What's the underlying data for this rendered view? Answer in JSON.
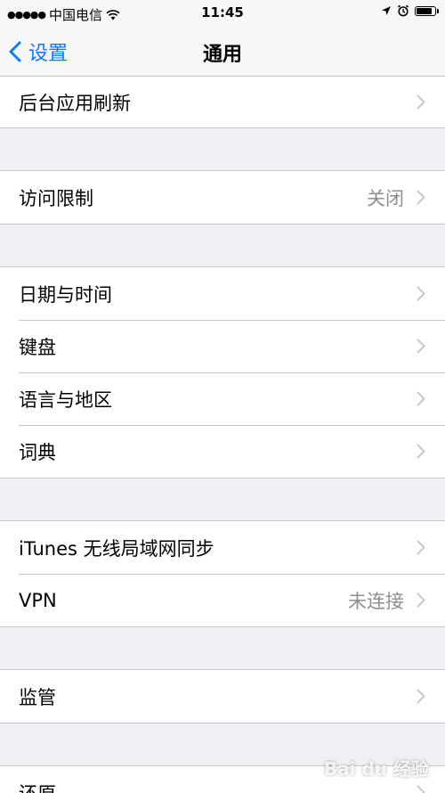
{
  "status_bar": {
    "carrier": "中国电信",
    "time": "11:45",
    "battery_level": 0.9,
    "signal_icon": "signal-dots",
    "wifi_icon": "wifi-icon",
    "location_icon": "location-arrow-icon",
    "alarm_icon": "alarm-icon"
  },
  "nav": {
    "back_label": "设置",
    "title": "通用"
  },
  "groups": [
    {
      "items": [
        {
          "label": "后台应用刷新",
          "value": ""
        }
      ]
    },
    {
      "items": [
        {
          "label": "访问限制",
          "value": "关闭"
        }
      ]
    },
    {
      "items": [
        {
          "label": "日期与时间",
          "value": ""
        },
        {
          "label": "键盘",
          "value": ""
        },
        {
          "label": "语言与地区",
          "value": ""
        },
        {
          "label": "词典",
          "value": ""
        }
      ]
    },
    {
      "items": [
        {
          "label": "iTunes 无线局域网同步",
          "value": ""
        },
        {
          "label": "VPN",
          "value": "未连接"
        }
      ]
    },
    {
      "items": [
        {
          "label": "监管",
          "value": ""
        }
      ]
    },
    {
      "items": [
        {
          "label": "还原",
          "value": ""
        }
      ]
    }
  ],
  "watermark": {
    "text": "Bai du 经验"
  },
  "colors": {
    "accent": "#0a7aff",
    "secondary_text": "#8e8e93",
    "background": "#efeff4",
    "separator": "#c8c7cc"
  }
}
